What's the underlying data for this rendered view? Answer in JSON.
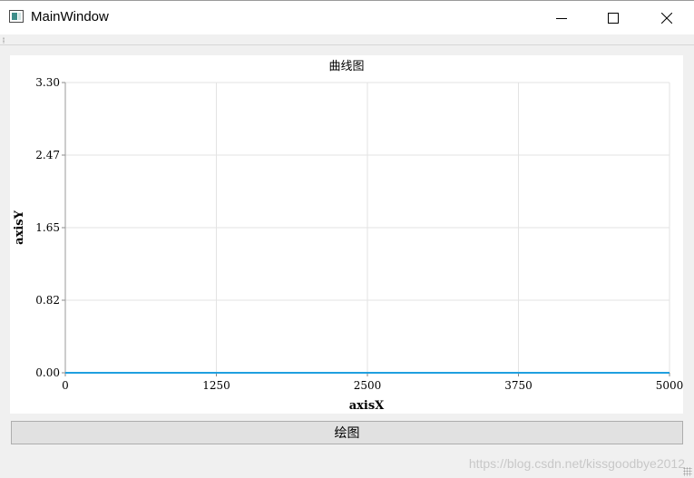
{
  "window": {
    "title": "MainWindow",
    "controls": {
      "minimize": "minimize",
      "maximize": "maximize",
      "close": "close"
    }
  },
  "main": {
    "draw_button_label": "绘图",
    "watermark": "https://blog.csdn.net/kissgoodbye2012"
  },
  "chart_data": {
    "type": "line",
    "title": "曲线图",
    "xlabel": "axisX",
    "ylabel": "axisY",
    "xlim": [
      0,
      5000
    ],
    "ylim": [
      0,
      3.3
    ],
    "x_ticks": [
      "0",
      "1250",
      "2500",
      "3750",
      "5000"
    ],
    "y_ticks": [
      "0.00",
      "0.82",
      "1.65",
      "2.47",
      "3.30"
    ],
    "grid": true,
    "series": [
      {
        "color": "#209fdf",
        "x": [
          0,
          5000
        ],
        "y": [
          0,
          0
        ]
      }
    ]
  }
}
